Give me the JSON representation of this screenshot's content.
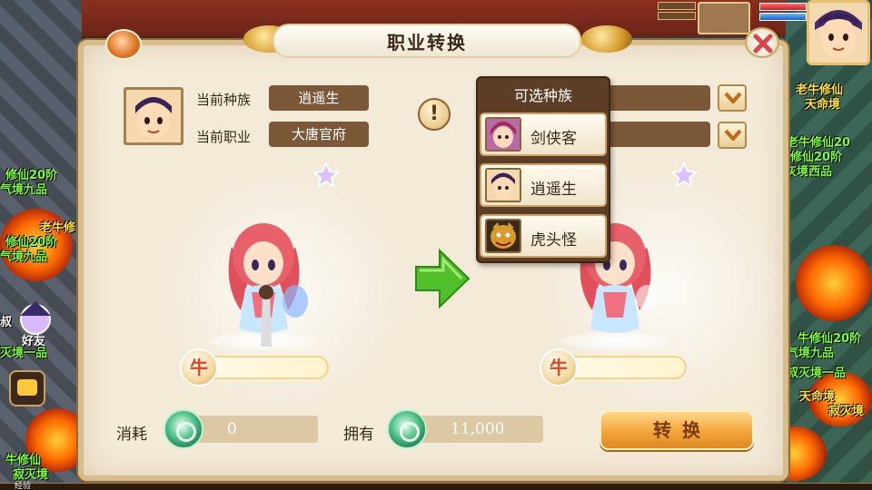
{
  "dialog": {
    "title": "职业转换",
    "current_race_label": "当前种族",
    "current_race_value": "逍遥生",
    "current_job_label": "当前职业",
    "current_job_value": "大唐官府",
    "help_symbol": "!"
  },
  "race_menu": {
    "title": "可选种族",
    "items": [
      {
        "label": "剑侠客",
        "icon": "jianxiake-portrait"
      },
      {
        "label": "逍遥生",
        "icon": "xiaoyaosheng-portrait"
      },
      {
        "label": "虎头怪",
        "icon": "hutouguai-portrait"
      }
    ]
  },
  "zodiac": {
    "left_symbol": "牛",
    "right_symbol": "牛"
  },
  "footer": {
    "cost_label": "消耗",
    "cost_value": "0",
    "own_label": "拥有",
    "own_value": "11,000",
    "convert_button": "转换"
  },
  "hud": {
    "friend_label": "好友",
    "exp_label": "经验"
  },
  "overhead_names": [
    "修仙20阶",
    "气境九品",
    "老牛修",
    "修仙20阶",
    "气境九品",
    "叔",
    "灭境一品",
    "老牛修仙",
    "天命境",
    "老牛修仙20",
    "修仙20阶",
    "灰境西品",
    "牛修仙20阶",
    "气境九品",
    "叔灭境一品",
    "天命境",
    "寂灭境",
    "牛修仙",
    "寂灭境"
  ],
  "colors": {
    "panel_bg": "#f3ead8",
    "value_box": "#7a5838",
    "convert_button": "#f2a53a",
    "coin": "#52c08a",
    "arrow": "#4fbf2a"
  }
}
